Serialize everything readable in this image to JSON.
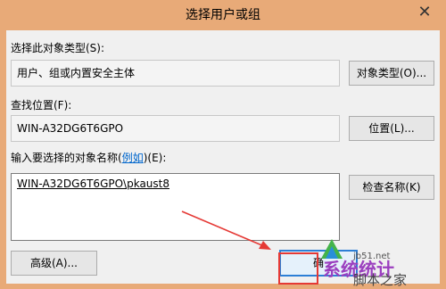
{
  "dialog": {
    "title": "选择用户或组",
    "close_glyph": "✕",
    "object_type": {
      "label": "选择此对象类型(S):",
      "value": "用户、组或内置安全主体",
      "button": "对象类型(O)..."
    },
    "location": {
      "label": "查找位置(F):",
      "value": "WIN-A32DG6T6GPO",
      "button": "位置(L)..."
    },
    "names": {
      "label_prefix": "输入要选择的对象名称(",
      "label_link": "例如",
      "label_suffix": ")(E):",
      "value": "WIN-A32DG6T6GPO\\pkaust8",
      "check_button": "检查名称(K)"
    },
    "advanced_button": "高级(A)...",
    "ok_button": "确"
  },
  "colors": {
    "titlebar": "#e8aa78",
    "annotation_arrow": "#e53935",
    "default_button_border": "#2c7fd6",
    "watermark": "#9b3fbf"
  },
  "watermark": {
    "line1": "系统统计",
    "line2": "脚本之家",
    "site": "jb51.net"
  }
}
